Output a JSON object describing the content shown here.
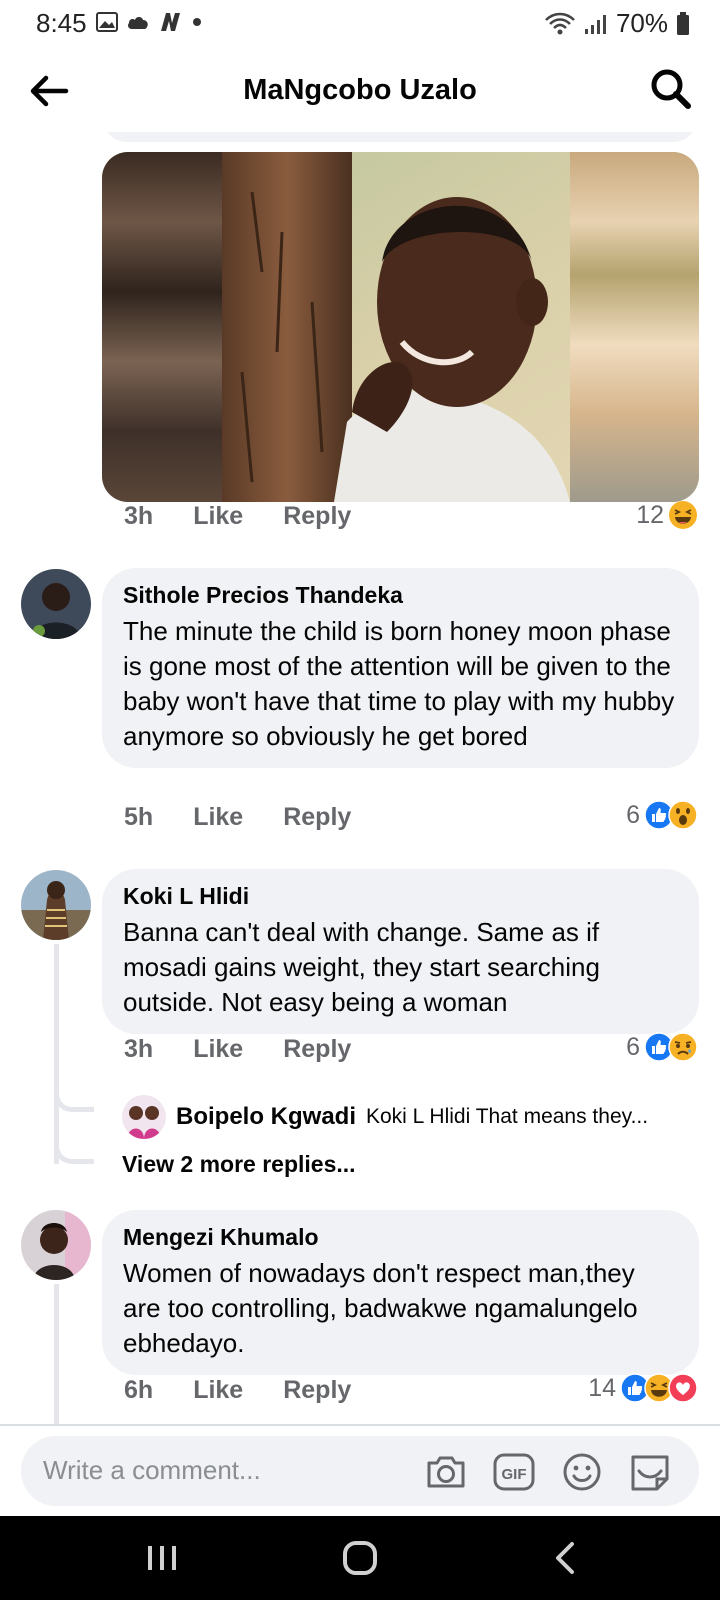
{
  "status": {
    "time": "8:45",
    "battery": "70%"
  },
  "header": {
    "title": "MaNgcobo Uzalo"
  },
  "gif_comment": {
    "time": "3h",
    "like": "Like",
    "reply": "Reply",
    "reaction_count": "12"
  },
  "comments": [
    {
      "name": "Sithole Precios Thandeka",
      "text": "The minute the child is born honey moon phase is gone most of the attention will be given to the baby won't have that time to play with my hubby anymore so obviously he get bored",
      "time": "5h",
      "like": "Like",
      "reply": "Reply",
      "reaction_count": "6"
    },
    {
      "name": "Koki L Hlidi",
      "text": "Banna can't deal with change. Same as if mosadi gains weight, they start searching outside.  Not easy being a woman",
      "time": "3h",
      "like": "Like",
      "reply": "Reply",
      "reaction_count": "6",
      "reply_preview": {
        "name": "Boipelo Kgwadi",
        "snippet": "Koki L Hlidi  That means they..."
      },
      "view_more": "View 2 more replies..."
    },
    {
      "name": "Mengezi Khumalo",
      "text": "Women of nowadays don't respect man,they are too controlling, badwakwe ngamalungelo ebhedayo.",
      "time": "6h",
      "like": "Like",
      "reply": "Reply",
      "reaction_count": "14"
    }
  ],
  "composer": {
    "placeholder": "Write a comment..."
  },
  "colors": {
    "bubble": "#f0f2f5",
    "secondary_text": "#65676b",
    "like_blue": "#1877f2",
    "haha_yellow": "#f7b125",
    "love_red": "#f33e58"
  }
}
